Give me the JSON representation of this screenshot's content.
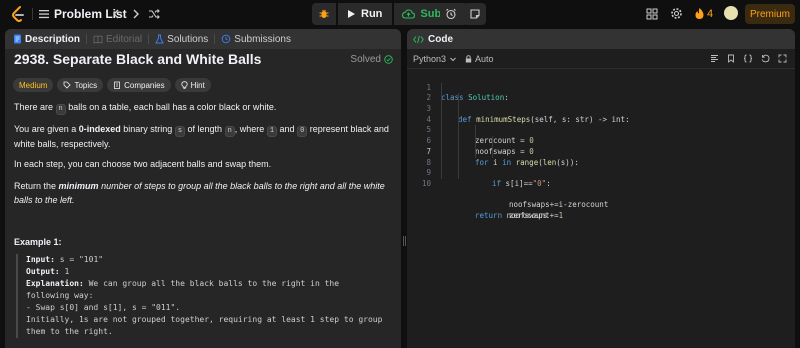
{
  "topbar": {
    "title": "Problem List",
    "run_label": "Run",
    "submit_label": "Submit",
    "streak": "4",
    "premium_label": "Premium"
  },
  "left": {
    "tabs": {
      "description": "Description",
      "editorial": "Editorial",
      "solutions": "Solutions",
      "submissions": "Submissions"
    },
    "title": "2938. Separate Black and White Balls",
    "status": "Solved",
    "chips": {
      "difficulty": "Medium",
      "topics": "Topics",
      "companies": "Companies",
      "hint": "Hint"
    },
    "p1": {
      "a": "There are",
      "code": "n",
      "b": "balls on a table, each ball has a color black or white."
    },
    "p2": {
      "a": "You are given a",
      "bold": "0-indexed",
      "b": "binary string",
      "code_s": "s",
      "c": "of length",
      "code_n": "n",
      "d": ", where",
      "code_1": "1",
      "e": "and",
      "code_0": "0",
      "f": "represent black and white balls, respectively."
    },
    "p3": "In each step, you can choose two adjacent balls and swap them.",
    "p4": {
      "a": "Return the",
      "bold": "minimum",
      "b": "number of steps to group all the black balls to the right and all the white balls to the left."
    },
    "example_heading": "Example 1:",
    "example": {
      "input_label": "Input:",
      "input_value": " s = \"101\"",
      "output_label": "Output:",
      "output_value": " 1",
      "explanation_label": "Explanation:",
      "explanation_1": " We can group all the black balls to the right in the",
      "explanation_2": "following way:",
      "explanation_3": "- Swap s[0] and s[1], s = \"011\".",
      "explanation_4": "Initially, 1s are not grouped together, requiring at least 1 step to group",
      "explanation_5": "them to the right."
    }
  },
  "right": {
    "header": "Code",
    "language": "Python3",
    "auto": "Auto",
    "line_numbers": [
      "1",
      "2",
      "3",
      "4",
      "5",
      "6",
      "7",
      "8",
      "9",
      "10"
    ],
    "code": {
      "l1_kw": "class",
      "l1_cls": "Solution",
      "l1_rest": ":",
      "l2_kw": "def",
      "l2_fn": "minimumSteps",
      "l2_rest": "(self, s: str) -> int:",
      "l3_a": "zerocount = ",
      "l3_num": "0",
      "l4_a": "noofswaps = ",
      "l4_num": "0",
      "l5_kw": "for",
      "l5_a": " i ",
      "l5_kw2": "in",
      "l5_fn": " range",
      "l5_b": "(",
      "l5_fn2": "len",
      "l5_c": "(s)):",
      "l6_kw": "if",
      "l6_a": " s[i]==",
      "l6_str": "\"0\"",
      "l6_b": ":",
      "l7": "noofswaps+=i-zerocount",
      "l8_a": "zerocount+=",
      "l8_num": "1",
      "l10_kw": "return",
      "l10_a": " noofswaps"
    }
  },
  "colors": {
    "accent_orange": "#ffa116",
    "success_green": "#2cbb5d",
    "medium_yellow": "#ffc01e"
  }
}
